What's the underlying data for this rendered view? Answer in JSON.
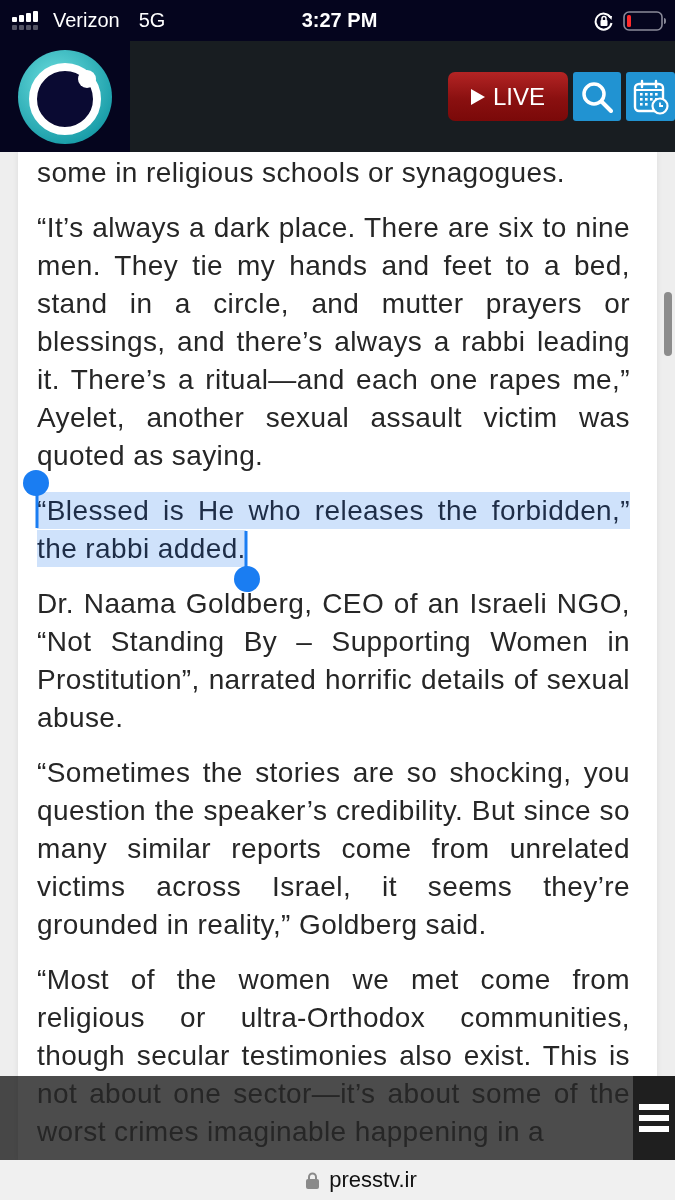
{
  "status_bar": {
    "carrier": "Verizon",
    "network": "5G",
    "time": "3:27 PM"
  },
  "header": {
    "live_label": "LIVE"
  },
  "article": {
    "paragraphs": [
      {
        "text": "some in religious schools or synagogues.",
        "selected": false
      },
      {
        "text": "“It’s always a dark place. There are six to nine men. They tie my hands and feet to a bed, stand in a circle, and mutter prayers or blessings, and there’s always a rabbi leading it. There’s a ritual—and each one rapes me,” Ayelet, another sexual assault victim was quoted as saying.",
        "selected": false
      },
      {
        "text": "“Blessed is He who releases the forbidden,” the rabbi added.",
        "selected": true
      },
      {
        "text": "Dr. Naama Goldberg, CEO of an Israeli NGO, “Not Standing By – Supporting Women in Prostitution”, narrated horrific details of sexual abuse.",
        "selected": false
      },
      {
        "text": "“Sometimes the stories are so shocking, you question the speaker’s credibility. But since so many similar reports come from unrelated victims across Israel, it seems they’re grounded in reality,” Goldberg said.",
        "selected": false
      },
      {
        "text": "“Most of the women we met come from religious or ultra-Orthodox communities, though secular testimonies also exist. This is not about one sector—it’s about some of the worst crimes imaginable happening in a",
        "selected": false
      }
    ]
  },
  "address_bar": {
    "url": "presstv.ir"
  }
}
